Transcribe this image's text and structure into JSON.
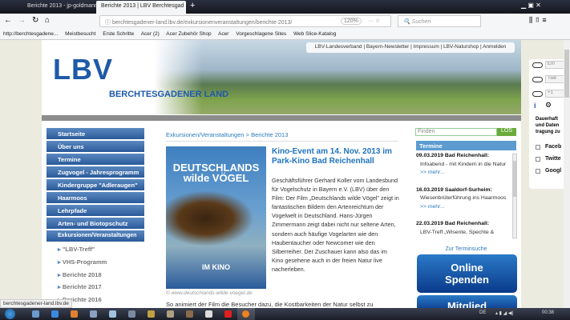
{
  "browser": {
    "tabs": [
      {
        "label": "Berichte 2013 - jp-goldmanns"
      },
      {
        "label": "Berichte 2013 | LBV Berchtesgad"
      }
    ],
    "url": "berchtesgadener-land.lbv.de/exkursionenveranstaltungen/berichte-2013/",
    "zoom": "120%",
    "search_placeholder": "Suchen",
    "bookmarks": [
      "http://berchtesgadene...",
      "Meistbesucht",
      "Erste Schritte",
      "Acer (2)",
      "Acer Zubehör Shop",
      "Acer",
      "Vorgeschlagene Sites",
      "Web Slice-Katalog"
    ],
    "status_url": "berchtesgadener-land.lbv.de"
  },
  "header": {
    "logo": "LBV",
    "logo_sub": "BERCHTESGADENER LAND",
    "top_links": "LBV-Landesverband | Bayern-Newsletter | Impressum | LBV-Naturshop | Anmelden"
  },
  "nav": {
    "items": [
      "Startseite",
      "Über uns",
      "Termine",
      "Zugvogel - Jahresprogramm",
      "Kindergruppe \"Adleraugen\"",
      "Haarmoos",
      "Lehrpfade",
      "Arten- und Biotopschutz",
      "Exkursionen/Veranstaltungen"
    ],
    "sub_items": [
      "\"LBV-Treff\"",
      "VHS-Programm",
      "Berichte 2018",
      "Berichte 2017",
      "Berichte 2016"
    ]
  },
  "article": {
    "breadcrumb": "Exkursionen/Veranstaltungen > Berichte 2013",
    "poster_title": "DEUTSCHLANDS wilde VÖGEL",
    "poster_kino": "IM KINO",
    "caption": "© www.deutschlands-wilde-voegel.de",
    "headline": "Kino-Event am 14. Nov. 2013 im Park-Kino Bad Reichenhall",
    "body": "Geschäftsführer Gerhard Koller vom Landesbund für Vogelschutz in Bayern e.V. (LBV) über den Film: Der Film „Deutschlands wilde Vögel\" zeigt in fantastischen Bildern den Artenreichtum der Vogelwelt in Deutschland. Hans-Jürgen Zimmermann zeigt dabei nicht nur seltene Arten, sondern auch häufige Vogelarten wie den Haubentaucher oder Newcomer wie den Silberreiher. Der Zuschauer kann also das im Kino gesehene auch in der freien Natur live nacherleben.",
    "bottom": "So animiert der Film die Besucher dazu, die Kostbarkeiten der Natur selbst zu"
  },
  "sidebar": {
    "find_placeholder": "Finden",
    "find_button": "LOS",
    "termine_title": "Termine",
    "events": [
      {
        "date": "09.03.2019 Bad Reichenhall:",
        "text": "Infoabend - mit Kindern in die Natur",
        "more": ">> mehr..."
      },
      {
        "date": "16.03.2019 Saaldorf-Surheim:",
        "text": "Wiesenbrüterführung ins Haarmoos",
        "more": ">> mehr..."
      },
      {
        "date": "22.03.2019 Bad Reichenhall:",
        "text": "LBV-Treff „Wisente, Spechte &",
        "more": ""
      }
    ],
    "termsuche": "Zur Terminsuche",
    "spenden": "Online Spenden",
    "mitglied": "Mitglied"
  },
  "social": {
    "buttons": [
      "Em",
      "Twe",
      "+1"
    ],
    "info_text": "Dauerhaft und Daten tragung zu",
    "checks": [
      "Faceb",
      "Twitte",
      "Googl"
    ]
  },
  "taskbar": {
    "lang": "DE",
    "time": "00:38"
  }
}
